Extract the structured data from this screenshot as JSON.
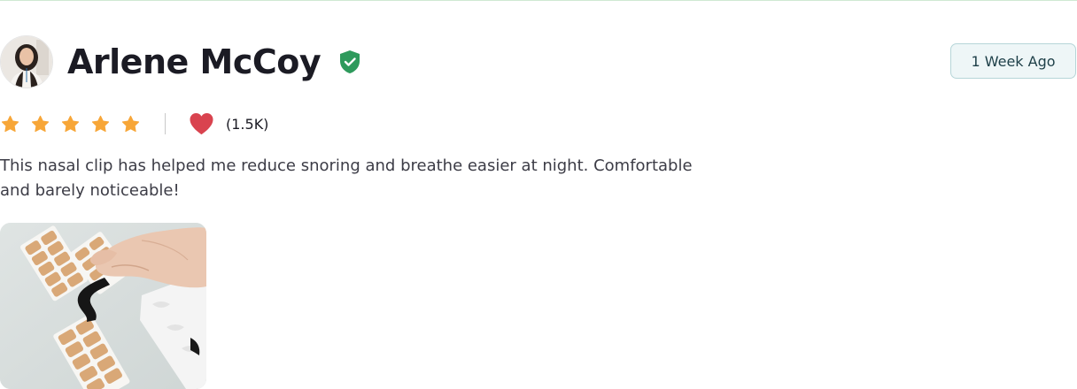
{
  "review": {
    "reviewer_name": "Arlene McCoy",
    "verified_icon": "verified-shield-check-icon",
    "time_ago": "1 Week Ago",
    "rating": 5,
    "rating_max": 5,
    "star_icon": "star-icon",
    "star_color": "#f7a638",
    "like_icon": "heart-icon",
    "like_color": "#d9434f",
    "likes_count": "(1.5K)",
    "text": "This nasal clip has helped me reduce snoring and breathe easier at night. Comfortable and barely noticeable!",
    "photo_icon": "review-photo-image",
    "accent_green": "#2e9a5c"
  }
}
